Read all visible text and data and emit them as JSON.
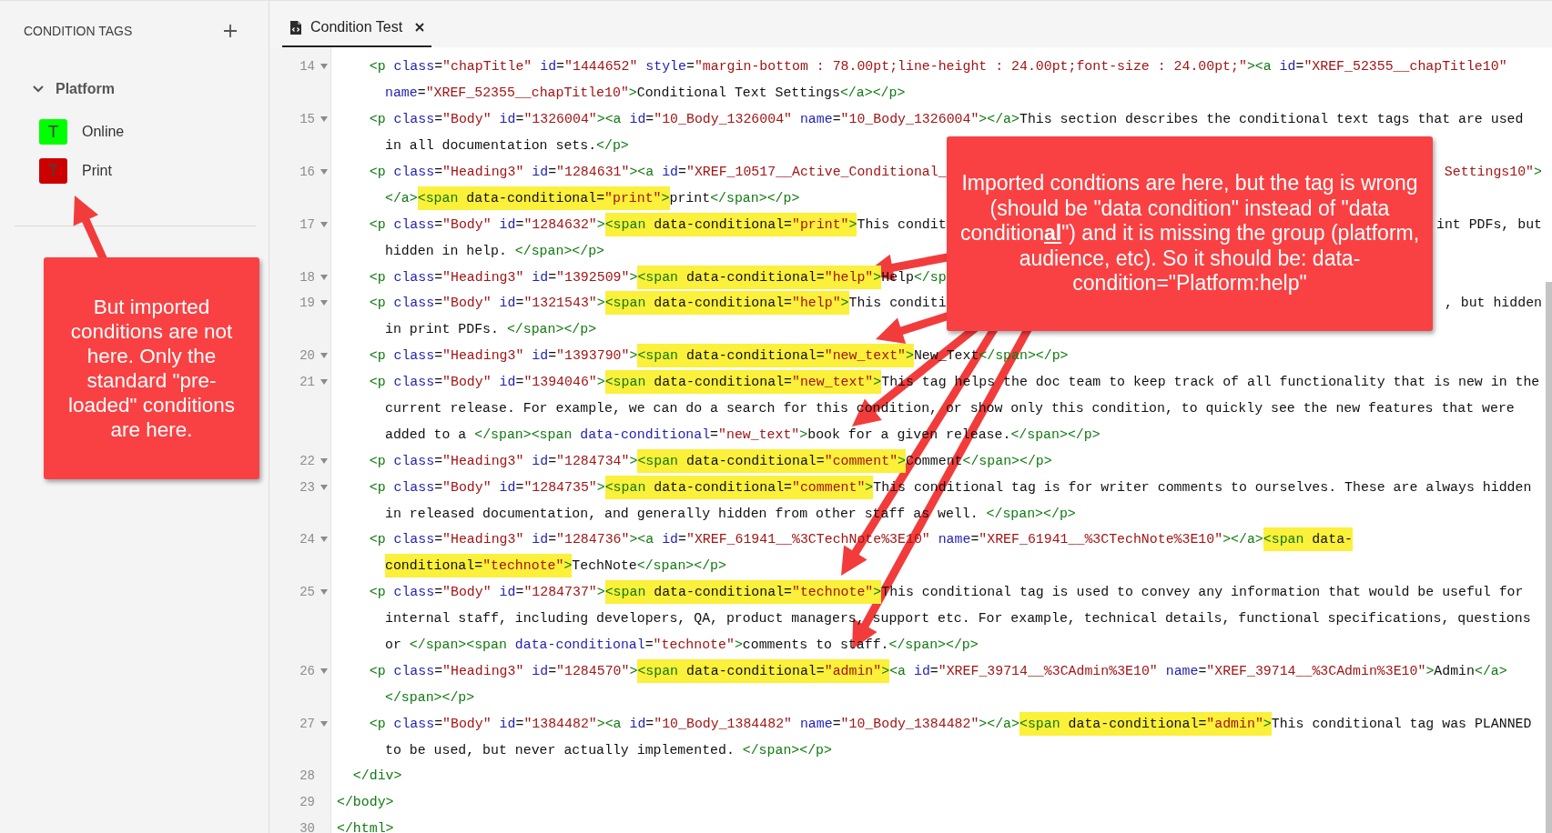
{
  "sidebar": {
    "title": "CONDITION TAGS",
    "groups": [
      {
        "label": "Platform",
        "expanded": true,
        "tags": [
          {
            "badge": "T",
            "label": "Online",
            "color": "#00ff00"
          },
          {
            "badge": "T",
            "label": "Print",
            "color": "#cc0000"
          }
        ]
      }
    ]
  },
  "tabs": [
    {
      "label": "Condition Test",
      "selected": true
    }
  ],
  "editor": {
    "lines": [
      {
        "number": "14",
        "foldable": true,
        "rows": [
          {
            "segments": [
              {
                "text": "    <p class=\"chapTitle\" id=\"1444652\" style=\"margin-bottom : 78.00pt;line-height : 24.00pt;font-size : 24.00pt;\"><a id=\"XREF_52355__chapTitle10\"",
                "highlighted": false
              }
            ]
          },
          {
            "segments": [
              {
                "text": "name=\"XREF_52355__chapTitle10\">Conditional Text Settings</a></p>",
                "highlighted": false
              }
            ]
          }
        ]
      },
      {
        "number": "15",
        "foldable": true,
        "rows": [
          {
            "segments": [
              {
                "text": "    <p class=\"Body\" id=\"1326004\"><a id=\"10_Body_1326004\" name=\"10_Body_1326004\"></a>This section describes the conditional text tags that are used",
                "highlighted": false
              }
            ]
          },
          {
            "segments": [
              {
                "text": "in all documentation sets.</p>",
                "highlighted": false
              }
            ]
          }
        ]
      },
      {
        "number": "16",
        "foldable": true,
        "rows": [
          {
            "segments": [
              {
                "text": "    <p class=\"Heading3\" id=\"1284631\"><a id=\"XREF_10517__Active_Conditional_",
                "highlighted": false
              }
            ],
            "tail": [
              {
                "text": "Settings10\">",
                "highlighted": false
              }
            ]
          },
          {
            "segments": [
              {
                "text": "</a>",
                "highlighted": false
              },
              {
                "text": "<span data-conditional=\"print\">",
                "highlighted": true
              },
              {
                "text": "print</span></p>",
                "highlighted": false
              }
            ]
          }
        ]
      },
      {
        "number": "17",
        "foldable": true,
        "rows": [
          {
            "segments": [
              {
                "text": "    <p class=\"Body\" id=\"1284632\">",
                "highlighted": false
              },
              {
                "text": "<span data-conditional=\"print\">",
                "highlighted": true
              },
              {
                "text": "This condit",
                "highlighted": false
              }
            ],
            "tail": [
              {
                "text": "int PDFs, but",
                "highlighted": false
              }
            ]
          },
          {
            "segments": [
              {
                "text": "hidden in help. </span></p>",
                "highlighted": false
              }
            ]
          }
        ]
      },
      {
        "number": "18",
        "foldable": true,
        "rows": [
          {
            "segments": [
              {
                "text": "    <p class=\"Heading3\" id=\"1392509\">",
                "highlighted": false
              },
              {
                "text": "<span data-conditional=\"help\">",
                "highlighted": true
              },
              {
                "text": "Help</sp",
                "highlighted": false
              }
            ]
          }
        ]
      },
      {
        "number": "19",
        "foldable": true,
        "rows": [
          {
            "segments": [
              {
                "text": "    <p class=\"Body\" id=\"1321543\">",
                "highlighted": false
              },
              {
                "text": "<span data-conditional=\"help\">",
                "highlighted": true
              },
              {
                "text": "This conditi",
                "highlighted": false
              }
            ],
            "tail": [
              {
                "text": ", but hidden",
                "highlighted": false
              }
            ]
          },
          {
            "segments": [
              {
                "text": "in print PDFs. </span></p>",
                "highlighted": false
              }
            ]
          }
        ]
      },
      {
        "number": "20",
        "foldable": true,
        "rows": [
          {
            "segments": [
              {
                "text": "    <p class=\"Heading3\" id=\"1393790\">",
                "highlighted": false
              },
              {
                "text": "<span data-conditional=\"new_text\">",
                "highlighted": true
              },
              {
                "text": "New_Text</span></p>",
                "highlighted": false
              }
            ]
          }
        ]
      },
      {
        "number": "21",
        "foldable": true,
        "rows": [
          {
            "segments": [
              {
                "text": "    <p class=\"Body\" id=\"1394046\">",
                "highlighted": false
              },
              {
                "text": "<span data-conditional=\"new_text\">",
                "highlighted": true
              },
              {
                "text": "This tag helps the doc team to keep track of all functionality that is new in the",
                "highlighted": false
              }
            ]
          },
          {
            "segments": [
              {
                "text": "current release. For example, we can do a search for this condition, or show only this condition, to quickly see the new features that were",
                "highlighted": false
              }
            ]
          },
          {
            "segments": [
              {
                "text": "added to a </span><span data-conditional=\"new_text\">book for a given release.</span></p>",
                "highlighted": false
              }
            ]
          }
        ]
      },
      {
        "number": "22",
        "foldable": true,
        "rows": [
          {
            "segments": [
              {
                "text": "    <p class=\"Heading3\" id=\"1284734\">",
                "highlighted": false
              },
              {
                "text": "<span data-conditional=\"comment\">",
                "highlighted": true
              },
              {
                "text": "Comment</span></p>",
                "highlighted": false
              }
            ]
          }
        ]
      },
      {
        "number": "23",
        "foldable": true,
        "rows": [
          {
            "segments": [
              {
                "text": "    <p class=\"Body\" id=\"1284735\">",
                "highlighted": false
              },
              {
                "text": "<span data-conditional=\"comment\">",
                "highlighted": true
              },
              {
                "text": "This conditional tag is for writer comments to ourselves. These are always hidden",
                "highlighted": false
              }
            ]
          },
          {
            "segments": [
              {
                "text": "in released documentation, and generally hidden from other staff as well. </span></p>",
                "highlighted": false
              }
            ]
          }
        ]
      },
      {
        "number": "24",
        "foldable": true,
        "rows": [
          {
            "segments": [
              {
                "text": "    <p class=\"Heading3\" id=\"1284736\"><a id=\"XREF_61941__%3CTechNote%3E10\" name=\"XREF_61941__%3CTechNote%3E10\"></a>",
                "highlighted": false
              },
              {
                "text": "<span data-",
                "highlighted": true
              }
            ]
          },
          {
            "segments": [
              {
                "text": "conditional=\"technote\">",
                "highlighted": true
              },
              {
                "text": "TechNote</span></p>",
                "highlighted": false
              }
            ]
          }
        ]
      },
      {
        "number": "25",
        "foldable": true,
        "rows": [
          {
            "segments": [
              {
                "text": "    <p class=\"Body\" id=\"1284737\">",
                "highlighted": false
              },
              {
                "text": "<span data-conditional=\"technote\">",
                "highlighted": true
              },
              {
                "text": "This conditional tag is used to convey any information that would be useful for",
                "highlighted": false
              }
            ]
          },
          {
            "segments": [
              {
                "text": "internal staff, including developers, QA, product managers, support etc. For example, technical details, functional specifications, questions",
                "highlighted": false
              }
            ]
          },
          {
            "segments": [
              {
                "text": "or </span><span data-conditional=\"technote\">comments to staff.</span></p>",
                "highlighted": false
              }
            ]
          }
        ]
      },
      {
        "number": "26",
        "foldable": true,
        "rows": [
          {
            "segments": [
              {
                "text": "    <p class=\"Heading3\" id=\"1284570\">",
                "highlighted": false
              },
              {
                "text": "<span data-conditional=\"admin\">",
                "highlighted": true
              },
              {
                "text": "<a id=\"XREF_39714__%3CAdmin%3E10\" name=\"XREF_39714__%3CAdmin%3E10\">Admin</a>",
                "highlighted": false
              }
            ]
          },
          {
            "segments": [
              {
                "text": "</span></p>",
                "highlighted": false
              }
            ]
          }
        ]
      },
      {
        "number": "27",
        "foldable": true,
        "rows": [
          {
            "segments": [
              {
                "text": "    <p class=\"Body\" id=\"1384482\"><a id=\"10_Body_1384482\" name=\"10_Body_1384482\"></a>",
                "highlighted": false
              },
              {
                "text": "<span data-conditional=\"admin\">",
                "highlighted": true
              },
              {
                "text": "This conditional tag was PLANNED",
                "highlighted": false
              }
            ]
          },
          {
            "segments": [
              {
                "text": "to be used, but never actually implemented. </span></p>",
                "highlighted": false
              }
            ]
          }
        ]
      },
      {
        "number": "28",
        "foldable": false,
        "rows": [
          {
            "segments": [
              {
                "text": "  </div>",
                "highlighted": false
              }
            ]
          }
        ]
      },
      {
        "number": "29",
        "foldable": false,
        "rows": [
          {
            "segments": [
              {
                "text": "</body>",
                "highlighted": false
              }
            ]
          }
        ]
      },
      {
        "number": "30",
        "foldable": false,
        "rows": [
          {
            "segments": [
              {
                "text": "</html>",
                "highlighted": false
              }
            ]
          }
        ]
      }
    ]
  },
  "annotations": [
    {
      "text": "But imported conditions are not here. Only the standard \"pre-loaded\" conditions are here."
    },
    {
      "text": "Imported condtions are here, but the tag is wrong (should be \"data condition\" instead of \"data condition**al**\") and it is missing the group (platform, audience, etc). So it should be: data-condition=\"Platform:help\""
    }
  ]
}
